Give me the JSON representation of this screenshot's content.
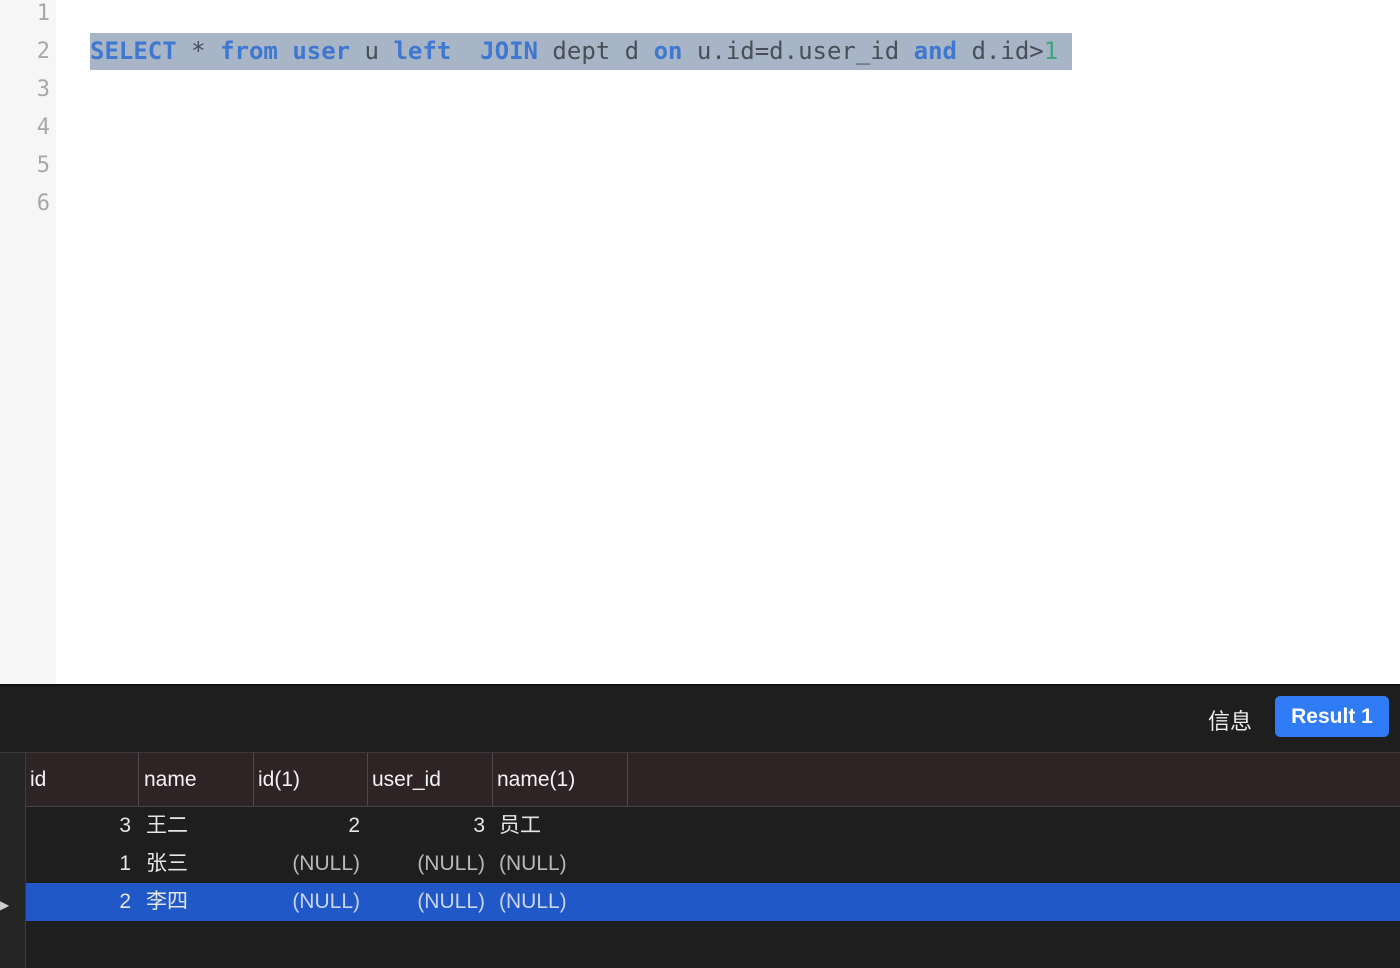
{
  "editor": {
    "line_numbers": [
      "1",
      "2",
      "3",
      "4",
      "5",
      "6"
    ],
    "sql_tokens": [
      {
        "text": "SELECT",
        "type": "kw"
      },
      {
        "text": " * ",
        "type": "op"
      },
      {
        "text": "from",
        "type": "kw"
      },
      {
        "text": " ",
        "type": "op"
      },
      {
        "text": "user",
        "type": "kw"
      },
      {
        "text": " u ",
        "type": "op"
      },
      {
        "text": "left",
        "type": "kw"
      },
      {
        "text": "  ",
        "type": "op"
      },
      {
        "text": "JOIN",
        "type": "kw"
      },
      {
        "text": " dept d ",
        "type": "op"
      },
      {
        "text": "on",
        "type": "kw"
      },
      {
        "text": " u.id=d.user_id ",
        "type": "op"
      },
      {
        "text": "and",
        "type": "kw"
      },
      {
        "text": " d.id>",
        "type": "op"
      },
      {
        "text": "1",
        "type": "num"
      }
    ]
  },
  "results": {
    "tabs": {
      "info_label": "信息",
      "result_label": "Result 1"
    },
    "columns": [
      "id",
      "name",
      "id(1)",
      "user_id",
      "name(1)"
    ],
    "rows": [
      [
        "3",
        "王二",
        "2",
        "3",
        "员工"
      ],
      [
        "1",
        "张三",
        "(NULL)",
        "(NULL)",
        "(NULL)"
      ],
      [
        "2",
        "李四",
        "(NULL)",
        "(NULL)",
        "(NULL)"
      ]
    ],
    "selected_row": 2,
    "colors": {
      "selection": "#2058c8",
      "accent": "#2f7cf6"
    }
  }
}
